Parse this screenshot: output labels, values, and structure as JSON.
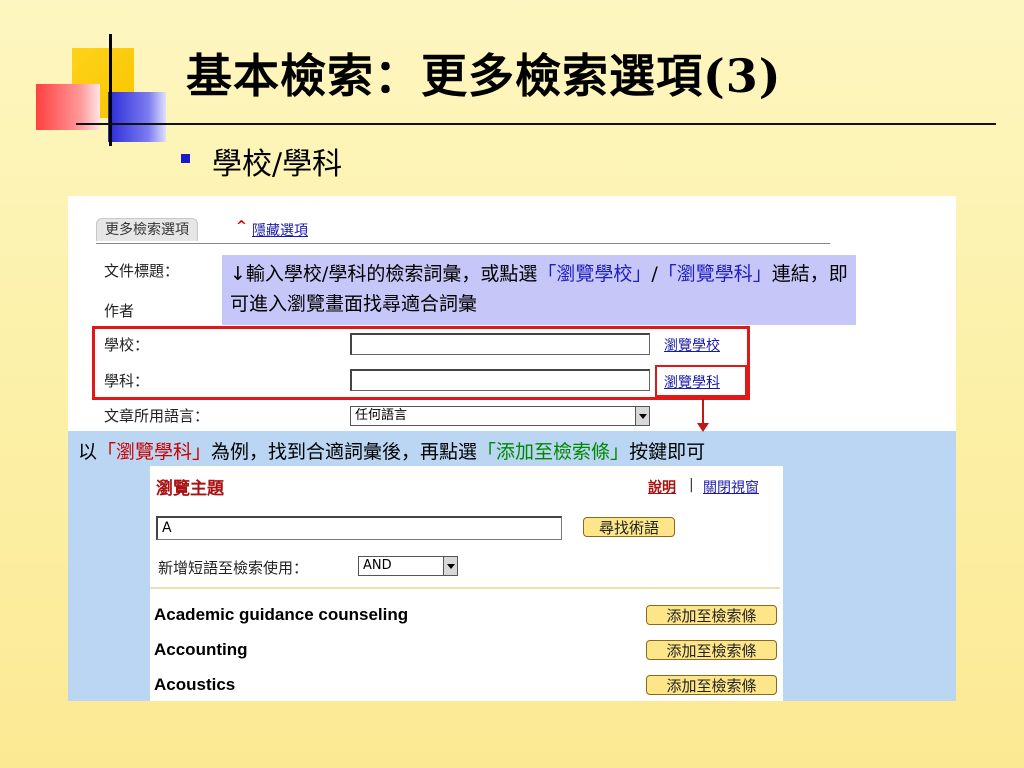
{
  "slide": {
    "title": "基本檢索：更多檢索選項(3)",
    "bullet": "學校/學科"
  },
  "screenshot": {
    "tab_label": "更多檢索選項",
    "hide_options_link": "隱藏選項",
    "rows": {
      "doc_title_label": "文件標題：",
      "author_label": "作者",
      "school_label": "學校：",
      "subject_label": "學科：",
      "language_label": "文章所用語言："
    },
    "tip": {
      "part1": "↓輸入學校/學科的檢索詞彙，或點選",
      "hl1": "「瀏覽學校」",
      "sep": "/",
      "hl2": "「瀏覽學科」",
      "part2": "連結，即可進入瀏覽畫面找尋適合詞彙"
    },
    "browse_school_link": "瀏覽學校",
    "browse_subject_link": "瀏覽學科",
    "language_select": "任何語言"
  },
  "caption": {
    "p1": "以",
    "r1": "「瀏覽學科」",
    "p2": "為例，找到合適詞彙後，再點選",
    "g1": "「添加至檢索條」",
    "p3": "按鍵即可"
  },
  "browse": {
    "title": "瀏覽主題",
    "help_link": "說明",
    "separator": "|",
    "close_link": "關閉視窗",
    "search_value": "A",
    "find_button": "尋找術語",
    "add_phrase_label": "新增短語至檢索使用：",
    "operator_select": "AND",
    "terms": [
      {
        "name": "Academic guidance counseling",
        "button": "添加至檢索條"
      },
      {
        "name": "Accounting",
        "button": "添加至檢索條"
      },
      {
        "name": "Acoustics",
        "button": "添加至檢索條"
      }
    ]
  },
  "colors": {
    "accent_red": "#e01818",
    "link_blue": "#1a1aaa",
    "highlight_green": "#008800"
  }
}
